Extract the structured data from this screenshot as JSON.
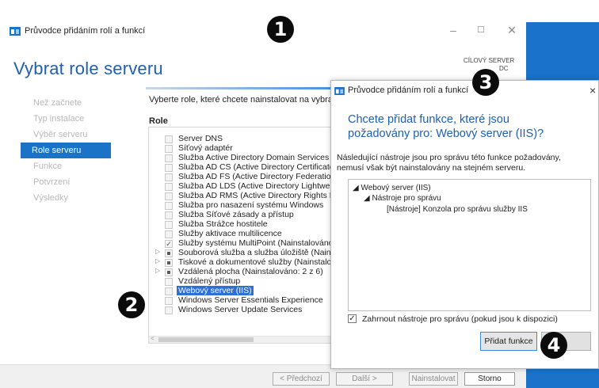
{
  "window": {
    "title": "Průvodce přidáním rolí a funkcí",
    "page_title": "Vybrat role serveru",
    "target_label": "CÍLOVÝ SERVER",
    "target_name": "DC"
  },
  "nav": [
    {
      "label": "Než začnete",
      "active": false
    },
    {
      "label": "Typ instalace",
      "active": false
    },
    {
      "label": "Výběr serveru",
      "active": false
    },
    {
      "label": "Role serveru",
      "active": true
    },
    {
      "label": "Funkce",
      "active": false
    },
    {
      "label": "Potvrzení",
      "active": false
    },
    {
      "label": "Výsledky",
      "active": false
    }
  ],
  "main": {
    "instruction": "Vyberte role, které chcete nainstalovat na vybraném",
    "roles_header": "Role"
  },
  "roles": [
    {
      "label": "Server DNS",
      "state": "unchecked",
      "expandable": false
    },
    {
      "label": "Síťový adaptér",
      "state": "unchecked",
      "expandable": false
    },
    {
      "label": "Služba Active Directory Domain Services",
      "state": "unchecked",
      "expandable": false
    },
    {
      "label": "Služba AD CS (Active Directory Certificate Se",
      "state": "unchecked",
      "expandable": false
    },
    {
      "label": "Služba AD FS (Active Directory Federation Se",
      "state": "unchecked",
      "expandable": false
    },
    {
      "label": "Služba AD LDS (Active Directory Lightweight",
      "state": "unchecked",
      "expandable": false
    },
    {
      "label": "Služba AD RMS (Active Directory Rights Man",
      "state": "unchecked",
      "expandable": false
    },
    {
      "label": "Služba pro nasazení systému Windows",
      "state": "unchecked",
      "expandable": false
    },
    {
      "label": "Služba Síťové zásady a přístup",
      "state": "unchecked",
      "expandable": false
    },
    {
      "label": "Služba Strážce hostitele",
      "state": "unchecked",
      "expandable": false
    },
    {
      "label": "Služby aktivace multilicence",
      "state": "unchecked",
      "expandable": false
    },
    {
      "label": "Služby systému MultiPoint (Nainstalováno)",
      "state": "checked",
      "expandable": false
    },
    {
      "label": "Souborová služba a služba úložiště (Nainsta",
      "state": "partial",
      "expandable": true
    },
    {
      "label": "Tiskové a dokumentové služby (Nainstalován",
      "state": "partial",
      "expandable": true
    },
    {
      "label": "Vzdálená plocha (Nainstalováno: 2 z 6)",
      "state": "partial",
      "expandable": true
    },
    {
      "label": "Vzdálený přístup",
      "state": "unchecked",
      "expandable": false
    },
    {
      "label": "Webový server (IIS)",
      "state": "unchecked",
      "expandable": false,
      "selected": true
    },
    {
      "label": "Windows Server Essentials Experience",
      "state": "unchecked",
      "expandable": false
    },
    {
      "label": "Windows Server Update Services",
      "state": "unchecked",
      "expandable": false
    }
  ],
  "footer": {
    "prev": "< Předchozí",
    "next": "Další >",
    "install": "Nainstalovat",
    "cancel": "Storno"
  },
  "dialog": {
    "title": "Průvodce přidáním rolí a funkcí",
    "close": "×",
    "heading": "Chcete přidat funkce, které jsou požadovány pro: Webový server (IIS)?",
    "description": "Následující nástroje jsou pro správu této funkce požadovány, nemusí však být nainstalovány na stejném serveru.",
    "tree": {
      "root": "Webový server (IIS)",
      "child": "Nástroje pro správu",
      "leaf": "[Nástroje] Konzola pro správu služby IIS"
    },
    "include_tools_label": "Zahrnout nástroje pro správu (pokud jsou k dispozici)",
    "include_tools_checked": true,
    "add_button": "Přidat funkce"
  },
  "annotations": [
    "1",
    "2",
    "3",
    "4"
  ],
  "colors": {
    "accent": "#1b73c8",
    "heading_blue": "#1e5fb0",
    "selection": "#2d6fd6"
  }
}
